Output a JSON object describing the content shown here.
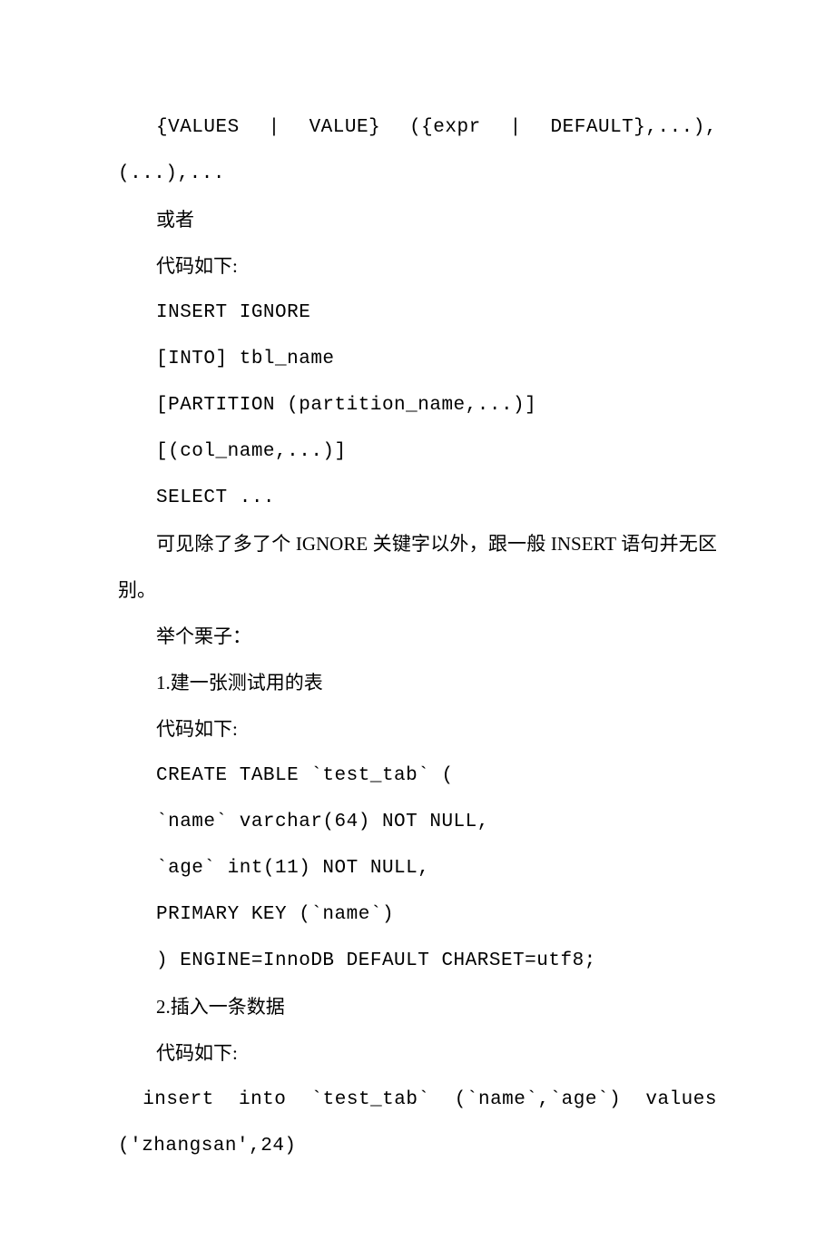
{
  "lines": [
    {
      "text": "{VALUES | VALUE} ({expr | DEFAULT},...),(...),...",
      "indent": true,
      "mono": true
    },
    {
      "text": "或者",
      "indent": true,
      "mono": false
    },
    {
      "text": "代码如下:",
      "indent": true,
      "mono": false
    },
    {
      "text": "INSERT IGNORE",
      "indent": true,
      "mono": true
    },
    {
      "text": "[INTO] tbl_name",
      "indent": true,
      "mono": true
    },
    {
      "text": "[PARTITION (partition_name,...)]",
      "indent": true,
      "mono": true
    },
    {
      "text": "[(col_name,...)]",
      "indent": true,
      "mono": true
    },
    {
      "text": "SELECT ...",
      "indent": true,
      "mono": true
    },
    {
      "text": "可见除了多了个 IGNORE 关键字以外，跟一般 INSERT 语句并无区别。",
      "indent": true,
      "mono": false
    },
    {
      "text": "举个栗子：",
      "indent": true,
      "mono": false
    },
    {
      "text": "1.建一张测试用的表",
      "indent": true,
      "mono": false
    },
    {
      "text": "代码如下:",
      "indent": true,
      "mono": false
    },
    {
      "text": "CREATE TABLE `test_tab` (",
      "indent": true,
      "mono": true
    },
    {
      "text": "`name` varchar(64) NOT NULL,",
      "indent": true,
      "mono": true
    },
    {
      "text": "`age` int(11) NOT NULL,",
      "indent": true,
      "mono": true
    },
    {
      "text": "PRIMARY KEY (`name`)",
      "indent": true,
      "mono": true
    },
    {
      "text": ") ENGINE=InnoDB DEFAULT CHARSET=utf8;",
      "indent": true,
      "mono": true
    },
    {
      "text": "2.插入一条数据",
      "indent": true,
      "mono": false
    },
    {
      "text": "代码如下:",
      "indent": true,
      "mono": false
    },
    {
      "text": "  insert  into  `test_tab`  (`name`,`age`)  values ('zhangsan',24)",
      "indent": false,
      "mono": true,
      "justify": true
    }
  ]
}
